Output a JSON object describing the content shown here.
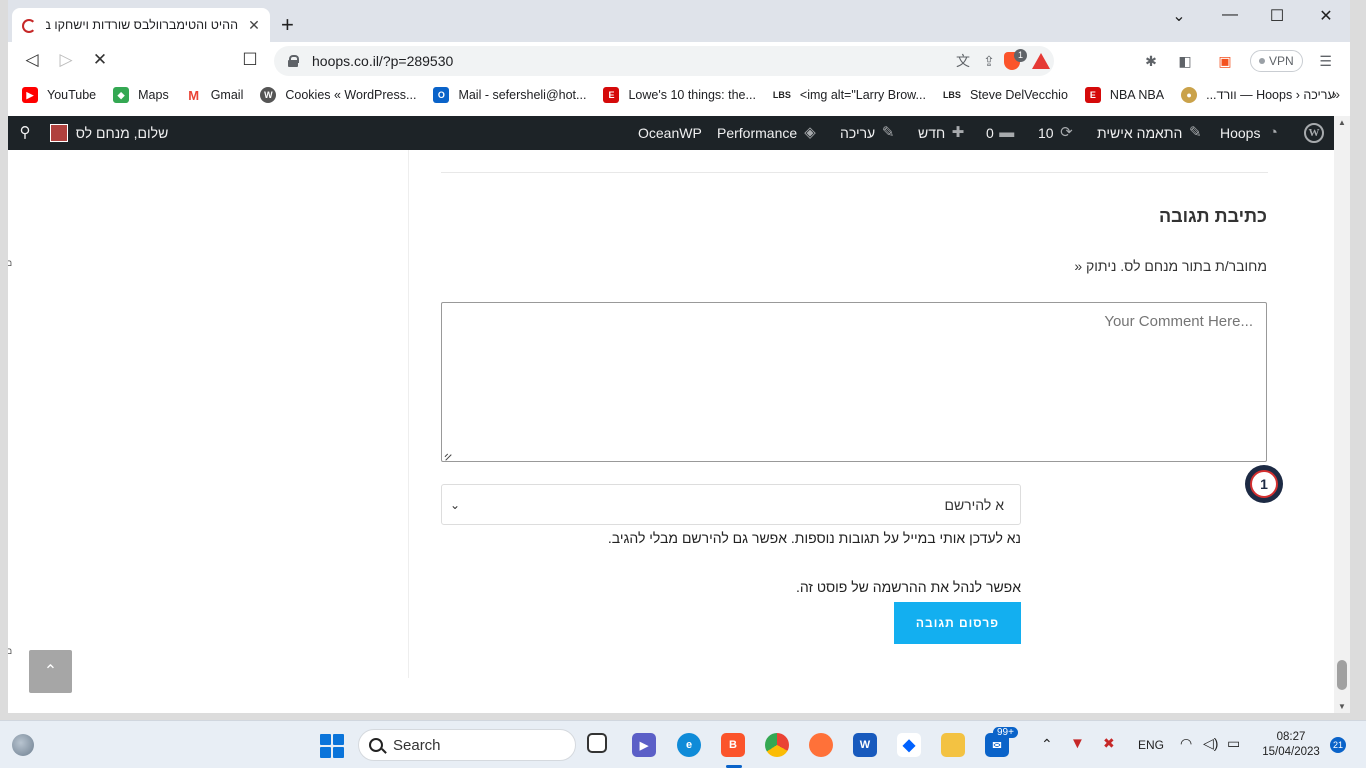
{
  "browser": {
    "tab_title": "ההיט והטימברוולבס שורדות וישחקו בג",
    "url": "hoops.co.il/?p=289530",
    "extension_badge": "1",
    "vpn_label": "VPN",
    "bookmarks": [
      {
        "label": "YouTube",
        "icon": "youtube-icon",
        "color": "#ff0000"
      },
      {
        "label": "Maps",
        "icon": "maps-icon",
        "color": "#34a853"
      },
      {
        "label": "Gmail",
        "icon": "gmail-icon",
        "color": "#ea4335"
      },
      {
        "label": "Cookies « WordPress...",
        "icon": "wordpress-icon",
        "color": "#555555"
      },
      {
        "label": "Mail - sefersheli@hot...",
        "icon": "outlook-icon",
        "color": "#0a63c9"
      },
      {
        "label": "Lowe's 10 things: the...",
        "icon": "espn-icon",
        "color": "#d50a0a"
      },
      {
        "label": "<img alt=\"Larry Brow...",
        "icon": "lbs-icon",
        "color": "#222222"
      },
      {
        "label": "Steve DelVecchio",
        "icon": "lbs-icon",
        "color": "#222222"
      },
      {
        "label": "NBA NBA",
        "icon": "espn-icon",
        "color": "#d50a0a"
      },
      {
        "label": "עריכה ‹ Hoops — וורד...",
        "icon": "hoops-icon",
        "color": "#caa24a"
      }
    ],
    "bookmarks_more": "»"
  },
  "admin_bar": {
    "site_name": "Hoops",
    "customize": "התאמה אישית",
    "updates_count": "10",
    "comments_count": "0",
    "new_label": "חדש",
    "edit_label": "עריכה",
    "performance_label": "Performance",
    "oceanwp_label": "OceanWP",
    "greeting": "שלום, מנחם לס"
  },
  "comment_form": {
    "title": "כתיבת תגובה",
    "logged_in_as": "מחובר/ת בתור מנחם לס. ניתוק «",
    "textarea_placeholder": "Your Comment Here...",
    "grammar_badge": "1",
    "subscribe_selected": "א להירשם",
    "notify_text": "נא לעדכן אותי במייל על תגובות נוספות. אפשר גם להירשם מבלי להגיב.",
    "manage_text": "אפשר לנהל את ההרשמה של פוסט זה.",
    "submit_label": "פרסום תגובה"
  },
  "taskbar": {
    "search_label": "Search",
    "mail_badge": "99+",
    "language": "ENG",
    "time": "08:27",
    "date": "15/04/2023",
    "notifications": "21"
  },
  "colors": {
    "accent": "#13aff0",
    "admin_bar": "#1d2327"
  }
}
